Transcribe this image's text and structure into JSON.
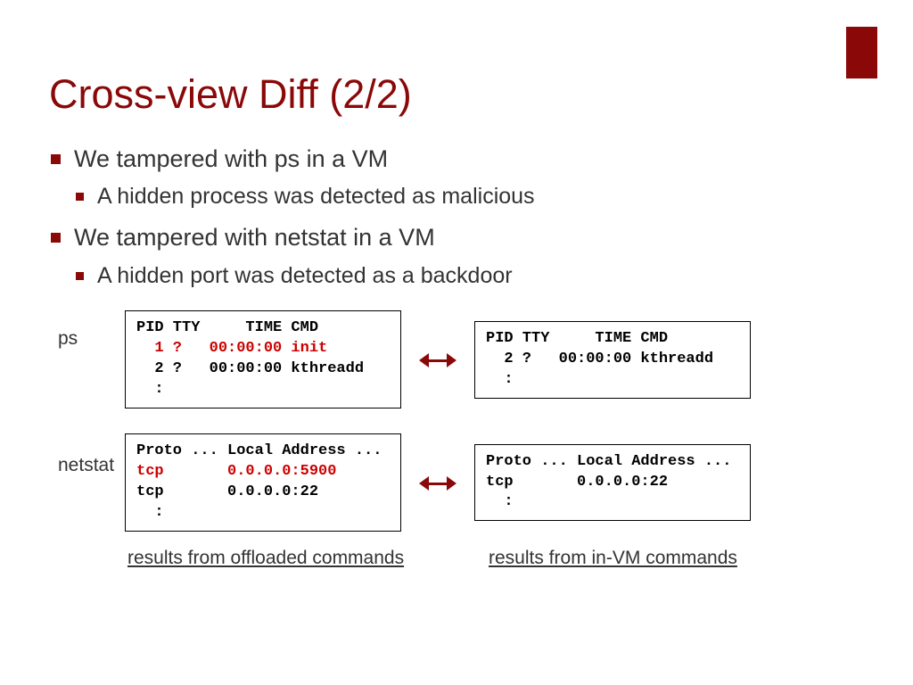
{
  "title": "Cross-view Diff (2/2)",
  "bullets": {
    "b1": "We tampered with ps in a VM",
    "b1a": "A hidden process was detected as malicious",
    "b2": "We tampered with netstat in a VM",
    "b2a": "A hidden port was detected as a backdoor"
  },
  "labels": {
    "ps": "ps",
    "netstat": "netstat"
  },
  "ps_left": {
    "header": "PID TTY     TIME CMD",
    "line1": "  1 ?   00:00:00 init",
    "line2": "  2 ?   00:00:00 kthreadd",
    "line3": "  :"
  },
  "ps_right": {
    "header": "PID TTY     TIME CMD",
    "line1": "  2 ?   00:00:00 kthreadd",
    "line2": "  :"
  },
  "net_left": {
    "header": "Proto ... Local Address ...",
    "line1a": "tcp",
    "line1b": "       0.0.0.0:5900",
    "line2": "tcp       0.0.0.0:22",
    "line3": "  :"
  },
  "net_right": {
    "header": "Proto ... Local Address ...",
    "line1": "tcp       0.0.0.0:22",
    "line2": "  :"
  },
  "captions": {
    "left": "results from offloaded commands",
    "right": "results from in-VM commands"
  }
}
